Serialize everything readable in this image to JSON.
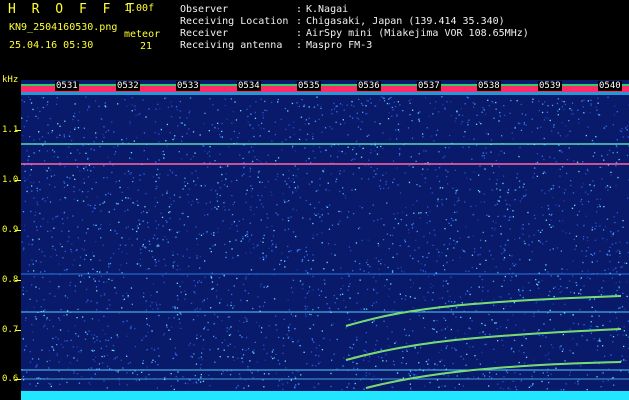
{
  "header": {
    "brand": "H R O F F T",
    "version": "1.00f",
    "filename": "KN9_2504160530.png",
    "meteor_label": "meteor",
    "timestamp": "25.04.16 05:30",
    "count": "21"
  },
  "info": {
    "rows": [
      {
        "label": "Observer",
        "sep": ":",
        "value": "K.Nagai"
      },
      {
        "label": "Receiving Location",
        "sep": ":",
        "value": "Chigasaki, Japan (139.414 35.340)"
      },
      {
        "label": "Receiver",
        "sep": ":",
        "value": "AirSpy mini (Miakejima VOR 108.65MHz)"
      },
      {
        "label": "Receiving antenna",
        "sep": ":",
        "value": "Maspro FM-3"
      }
    ]
  },
  "axis": {
    "unit": "kHz",
    "ticks": [
      "1.1",
      "1.0",
      "0.9",
      "0.8",
      "0.7",
      "0.6"
    ]
  },
  "time_labels": [
    "0531",
    "0532",
    "0533",
    "0534",
    "0535",
    "0536",
    "0537",
    "0538",
    "0539",
    "0540"
  ],
  "colors": {
    "background": "#0a1a6a",
    "text_accent": "#ffff33",
    "hot_band": "#ff2a6a"
  }
}
